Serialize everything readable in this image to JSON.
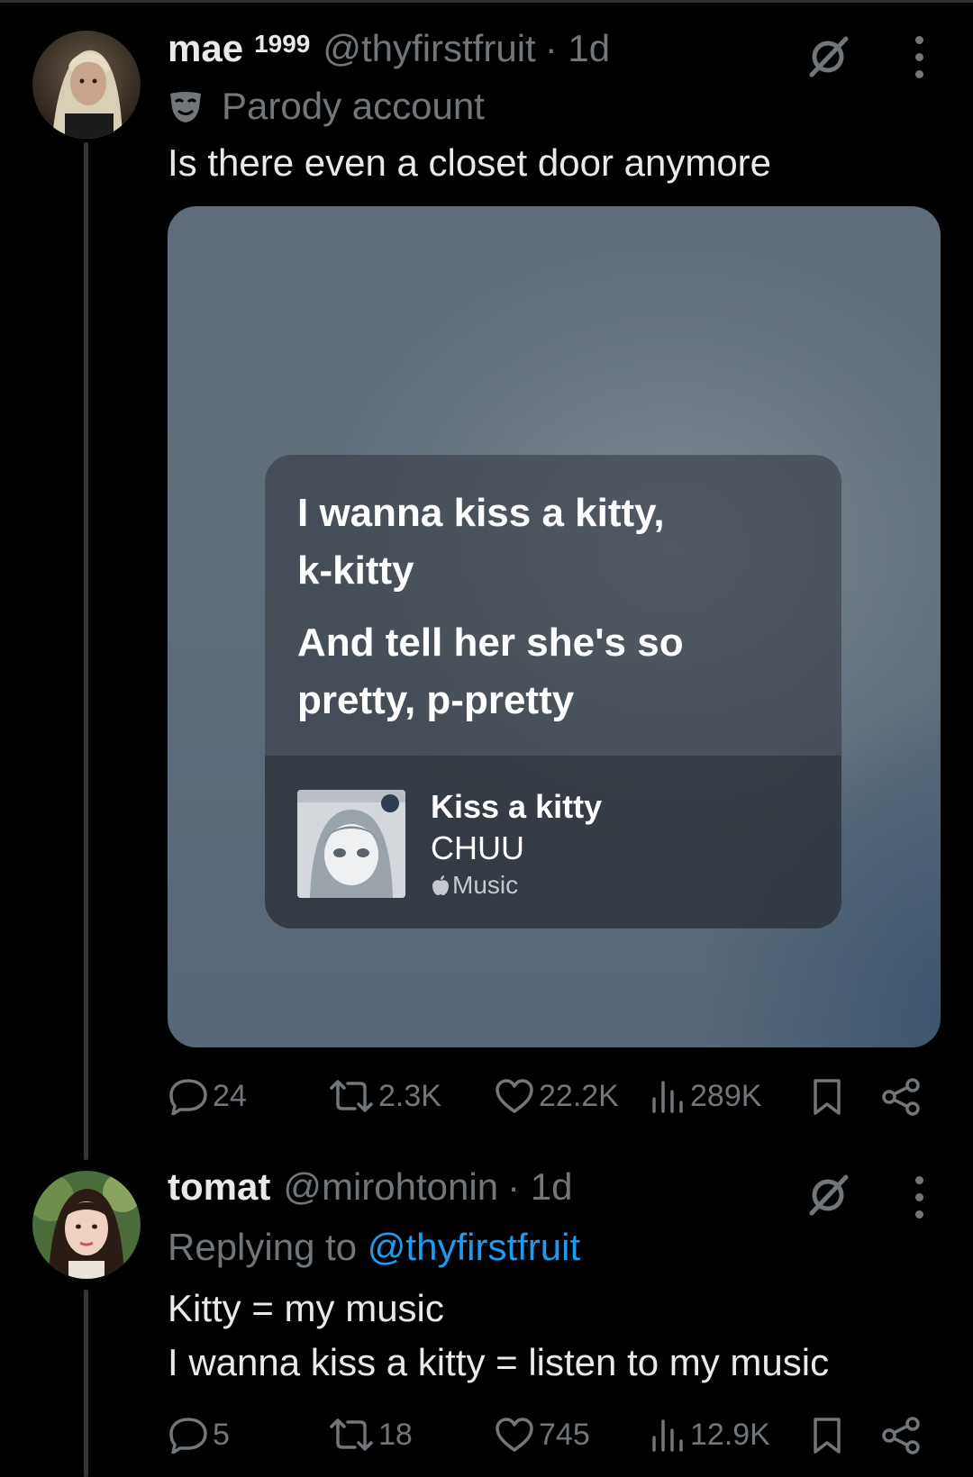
{
  "tweet1": {
    "name": "mae",
    "badge": "1999",
    "handle": "@thyfirstfruit",
    "time": "· 1d",
    "label": "Parody account",
    "text": "Is there even a closet door anymore",
    "lyrics": {
      "line1": "I wanna kiss a kitty,",
      "line2": "k-kitty",
      "line3": "And tell her she's so",
      "line4": "pretty, p-pretty"
    },
    "song": {
      "title": "Kiss a kitty",
      "artist": "CHUU",
      "source": "Music"
    },
    "stats": {
      "replies": "24",
      "reposts": "2.3K",
      "likes": "22.2K",
      "views": "289K"
    }
  },
  "tweet2": {
    "name": "tomat",
    "handle": "@mirohtonin",
    "time": "· 1d",
    "replying_prefix": "Replying to",
    "replying_handle": "@thyfirstfruit",
    "text_line1": "Kitty = my music",
    "text_line2": "I wanna kiss a kitty = listen to my music",
    "stats": {
      "replies": "5",
      "reposts": "18",
      "likes": "745",
      "views": "12.9K"
    }
  },
  "colors": {
    "background": "#000000",
    "text": "#e7e9ea",
    "muted": "#71767b",
    "link": "#1d9bf0"
  },
  "icons": [
    "grok-icon",
    "more-icon",
    "parody-mask-icon",
    "reply-icon",
    "repost-icon",
    "like-icon",
    "views-icon",
    "bookmark-icon",
    "share-icon",
    "apple-icon"
  ]
}
